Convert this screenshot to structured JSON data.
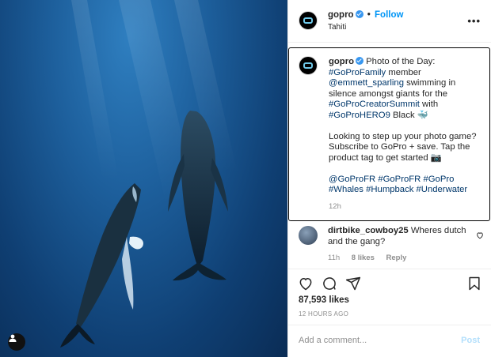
{
  "post": {
    "username": "gopro",
    "follow_label": "Follow",
    "separator": "•",
    "location": "Tahiti",
    "more_label": "•••"
  },
  "caption": {
    "username": "gopro",
    "line1_a": "Photo of the Day: ",
    "tag_family": "#GoProFamily",
    "line1_b": " member ",
    "mention": "@emmett_sparling",
    "line1_c": " swimming in silence amongst giants for the ",
    "tag_summit": "#GoProCreatorSummit",
    "line1_d": " with ",
    "tag_hero9": "#GoProHERO9",
    "line1_e": " Black 🐳",
    "para2": "Looking to step up your photo game? Subscribe to GoPro + save. Tap the product tag to get started 📷",
    "tags": [
      "@GoProFR",
      "#GoProFR",
      "#GoPro",
      "#Whales",
      "#Humpback",
      "#Underwater"
    ],
    "time": "12h"
  },
  "comment": {
    "username": "dirtbike_cowboy25",
    "text": " Wheres dutch and the gang?",
    "time": "11h",
    "likes": "8 likes",
    "reply": "Reply"
  },
  "stats": {
    "likes": "87,593 likes",
    "time_ago": "12 HOURS AGO"
  },
  "composer": {
    "placeholder": "Add a comment...",
    "post_label": "Post"
  },
  "icons": {
    "heart": "heart-icon",
    "comment": "comment-icon",
    "share": "share-icon",
    "save": "bookmark-icon",
    "more": "more-icon",
    "user_tag": "user-tag-icon"
  },
  "colors": {
    "link": "#00376b",
    "follow": "#0095f6",
    "verified": "#3897f0",
    "muted": "#8e8e8e",
    "post_disabled": "#b2dffc"
  }
}
